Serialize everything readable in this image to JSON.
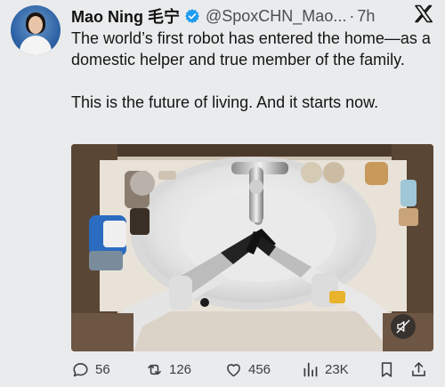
{
  "author": {
    "name": "Mao Ning 毛宁",
    "handle": "@SpoxCHN_Mao...",
    "separator": "·",
    "time": "7h"
  },
  "tweet": {
    "line1": "The world’s first robot has entered the home—as a domestic helper and true member of the family.",
    "line2": "This is the future of living. And it starts now."
  },
  "actions": {
    "replies": "56",
    "reposts": "126",
    "likes": "456",
    "views": "23K"
  },
  "icons": {
    "verified": "verified-badge-icon",
    "brand": "x-logo-icon",
    "reply": "reply-icon",
    "repost": "repost-icon",
    "like": "heart-icon",
    "views": "views-icon",
    "bookmark": "bookmark-icon",
    "share": "share-icon",
    "mute": "muted-speaker-icon"
  },
  "colors": {
    "background": "#e9ebec",
    "text": "#151515",
    "muted": "#4b4f54",
    "verified": "#1d9bf0"
  }
}
